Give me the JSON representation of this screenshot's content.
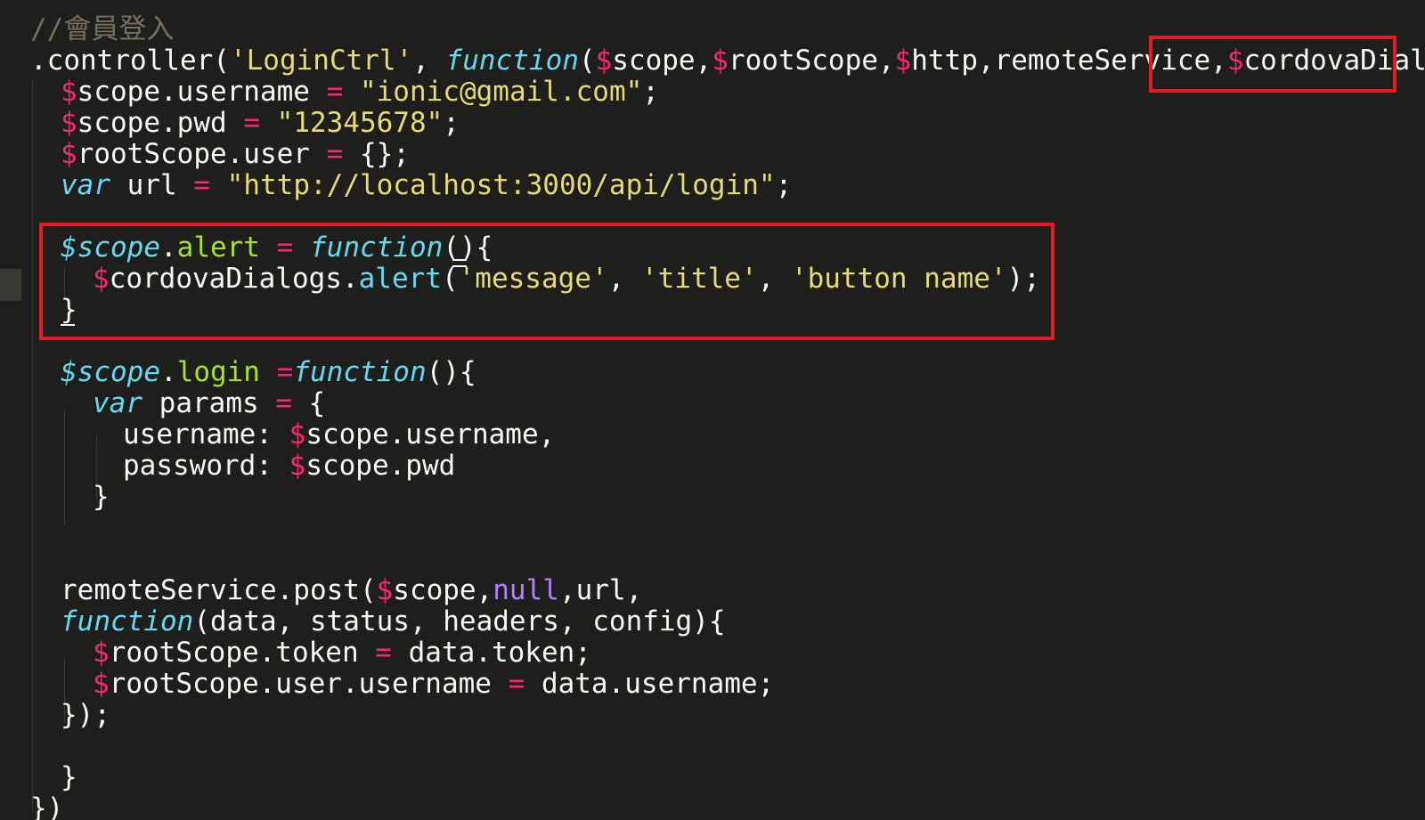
{
  "editor": {
    "theme_colors": {
      "background": "#1e1f1c",
      "plain": "#f8f8f2",
      "comment": "#75715e",
      "string": "#e6db74",
      "keyword": "#66d9ef",
      "operator": "#f92672",
      "property": "#a6e22e",
      "constant": "#ae81ff",
      "highlight_box": "#e01b24"
    },
    "lines": [
      [
        {
          "t": "comment",
          "v": "//會員登入"
        }
      ],
      [
        {
          "t": "plain",
          "v": ".controller("
        },
        {
          "t": "string",
          "v": "'LoginCtrl'"
        },
        {
          "t": "plain",
          "v": ", "
        },
        {
          "t": "keyword",
          "v": "function"
        },
        {
          "t": "plain",
          "v": "("
        },
        {
          "t": "dollar",
          "v": "$"
        },
        {
          "t": "plain",
          "v": "scope,"
        },
        {
          "t": "dollar",
          "v": "$"
        },
        {
          "t": "plain",
          "v": "rootScope,"
        },
        {
          "t": "dollar",
          "v": "$"
        },
        {
          "t": "plain",
          "v": "http,remoteService,"
        },
        {
          "t": "dollar",
          "v": "$"
        },
        {
          "t": "plain",
          "v": "cordovaDialogs"
        }
      ],
      [
        {
          "t": "dollar",
          "v": "$"
        },
        {
          "t": "plain",
          "v": "scope.username "
        },
        {
          "t": "op",
          "v": "="
        },
        {
          "t": "plain",
          "v": " "
        },
        {
          "t": "string",
          "v": "\"ionic@gmail.com\""
        },
        {
          "t": "plain",
          "v": ";"
        }
      ],
      [
        {
          "t": "dollar",
          "v": "$"
        },
        {
          "t": "plain",
          "v": "scope.pwd "
        },
        {
          "t": "op",
          "v": "="
        },
        {
          "t": "plain",
          "v": " "
        },
        {
          "t": "string",
          "v": "\"12345678\""
        },
        {
          "t": "plain",
          "v": ";"
        }
      ],
      [
        {
          "t": "dollar",
          "v": "$"
        },
        {
          "t": "plain",
          "v": "rootScope.user "
        },
        {
          "t": "op",
          "v": "="
        },
        {
          "t": "plain",
          "v": " {};"
        }
      ],
      [
        {
          "t": "var",
          "v": "var"
        },
        {
          "t": "plain",
          "v": " url "
        },
        {
          "t": "op",
          "v": "="
        },
        {
          "t": "plain",
          "v": " "
        },
        {
          "t": "string",
          "v": "\"http://localhost:3000/api/login\""
        },
        {
          "t": "plain",
          "v": ";"
        }
      ],
      [],
      [
        {
          "t": "var",
          "v": "$scope"
        },
        {
          "t": "plain",
          "v": "."
        },
        {
          "t": "prop",
          "v": "alert"
        },
        {
          "t": "plain",
          "v": " "
        },
        {
          "t": "op",
          "v": "="
        },
        {
          "t": "plain",
          "v": " "
        },
        {
          "t": "keyword",
          "v": "function"
        },
        {
          "t": "plain",
          "v": "(){"
        }
      ],
      [
        {
          "t": "dollar",
          "v": "$"
        },
        {
          "t": "plain",
          "v": "cordovaDialogs."
        },
        {
          "t": "method",
          "v": "alert"
        },
        {
          "t": "plain",
          "v": "("
        },
        {
          "t": "string",
          "v": "'message'"
        },
        {
          "t": "plain",
          "v": ", "
        },
        {
          "t": "string",
          "v": "'title'"
        },
        {
          "t": "plain",
          "v": ", "
        },
        {
          "t": "string",
          "v": "'button name'"
        },
        {
          "t": "plain",
          "v": ");"
        }
      ],
      [
        {
          "t": "plain",
          "v": "}"
        }
      ],
      [],
      [
        {
          "t": "var",
          "v": "$scope"
        },
        {
          "t": "plain",
          "v": "."
        },
        {
          "t": "prop",
          "v": "login"
        },
        {
          "t": "plain",
          "v": " "
        },
        {
          "t": "op",
          "v": "="
        },
        {
          "t": "keyword",
          "v": "function"
        },
        {
          "t": "plain",
          "v": "(){"
        }
      ],
      [
        {
          "t": "var",
          "v": "var"
        },
        {
          "t": "plain",
          "v": " params "
        },
        {
          "t": "op",
          "v": "="
        },
        {
          "t": "plain",
          "v": " {"
        }
      ],
      [
        {
          "t": "plain",
          "v": "username: "
        },
        {
          "t": "dollar",
          "v": "$"
        },
        {
          "t": "plain",
          "v": "scope.username,"
        }
      ],
      [
        {
          "t": "plain",
          "v": "password: "
        },
        {
          "t": "dollar",
          "v": "$"
        },
        {
          "t": "plain",
          "v": "scope.pwd"
        }
      ],
      [
        {
          "t": "plain",
          "v": "}"
        }
      ],
      [],
      [],
      [
        {
          "t": "plain",
          "v": "remoteService.post("
        },
        {
          "t": "dollar",
          "v": "$"
        },
        {
          "t": "plain",
          "v": "scope,"
        },
        {
          "t": "const",
          "v": "null"
        },
        {
          "t": "plain",
          "v": ",url,"
        }
      ],
      [
        {
          "t": "keyword",
          "v": "function"
        },
        {
          "t": "plain",
          "v": "(data, status, headers, config){"
        }
      ],
      [
        {
          "t": "dollar",
          "v": "$"
        },
        {
          "t": "plain",
          "v": "rootScope.token "
        },
        {
          "t": "op",
          "v": "="
        },
        {
          "t": "plain",
          "v": " data.token;"
        }
      ],
      [
        {
          "t": "dollar",
          "v": "$"
        },
        {
          "t": "plain",
          "v": "rootScope.user.username "
        },
        {
          "t": "op",
          "v": "="
        },
        {
          "t": "plain",
          "v": " data.username;"
        }
      ],
      [
        {
          "t": "plain",
          "v": "});"
        }
      ],
      [],
      [
        {
          "t": "plain",
          "v": "}"
        }
      ],
      [
        {
          "t": "plain",
          "v": "})"
        }
      ]
    ]
  }
}
